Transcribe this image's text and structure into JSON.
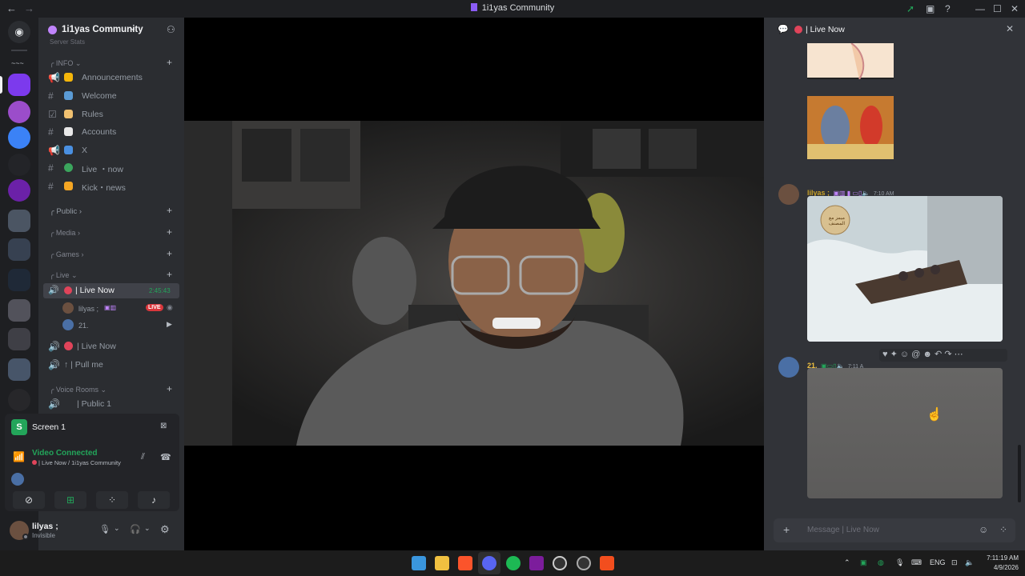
{
  "window": {
    "title": "1i1yas Community",
    "back_glyph": "←",
    "forward_glyph": "→"
  },
  "server": {
    "name": "1i1yas Community"
  },
  "sidebar": {
    "top_partial": "Server Stats",
    "categories": {
      "info": "INFO",
      "public": "Public",
      "media": "Media",
      "games": "Games",
      "live": "Live",
      "voice_rooms": "Voice Rooms"
    },
    "info_channels": [
      {
        "label": "Announcements",
        "icon": "megaphone-icon",
        "emoji_color": "#f5b60a"
      },
      {
        "label": "Welcome",
        "icon": "hash-icon",
        "emoji_color": "#5b9bd5"
      },
      {
        "label": "Rules",
        "icon": "rules-icon",
        "emoji_color": "#f0c070"
      },
      {
        "label": "Accounts",
        "icon": "hash-icon",
        "emoji_color": "#e8e8e8"
      },
      {
        "label": "X",
        "icon": "megaphone-icon",
        "emoji_color": "#4a90e2"
      },
      {
        "label": "Live ・now",
        "icon": "hash-icon",
        "emoji_color": "#3ba55d"
      },
      {
        "label": "Kick・news",
        "icon": "hash-icon",
        "emoji_color": "#f5a623"
      }
    ],
    "live_channel": {
      "label": "| Live Now",
      "timer": "2:45:43"
    },
    "live_members": [
      {
        "name": "lilyas ;",
        "tag": "LIVE"
      },
      {
        "name": "21."
      }
    ],
    "other_voice": [
      {
        "label": "| Live Now"
      },
      {
        "label": "↑ | Pull me"
      }
    ],
    "voice_room": "| Public 1"
  },
  "voice_panel": {
    "screen_label": "Screen 1",
    "status": "Video Connected",
    "location": "| Live Now / 1i1yas Community"
  },
  "user": {
    "name": "lilyas ;",
    "status": "Invisible"
  },
  "chat": {
    "channel": "| Live Now",
    "messages": [
      {
        "author": "lilyas ;",
        "time": "7:10 AM",
        "color": "#c9a227"
      },
      {
        "author": "21.",
        "time": "7:11 A",
        "color": "#f0c040"
      }
    ],
    "composer_placeholder": "Message  | Live Now",
    "meme_text": "ميمز مع المصنف"
  },
  "taskbar": {
    "tray_lang": "ENG",
    "time": "7:11:19 AM",
    "date": "4/9/2026"
  },
  "colors": {
    "accent": "#5865f2",
    "green": "#23a55a",
    "live": "#da373c"
  }
}
